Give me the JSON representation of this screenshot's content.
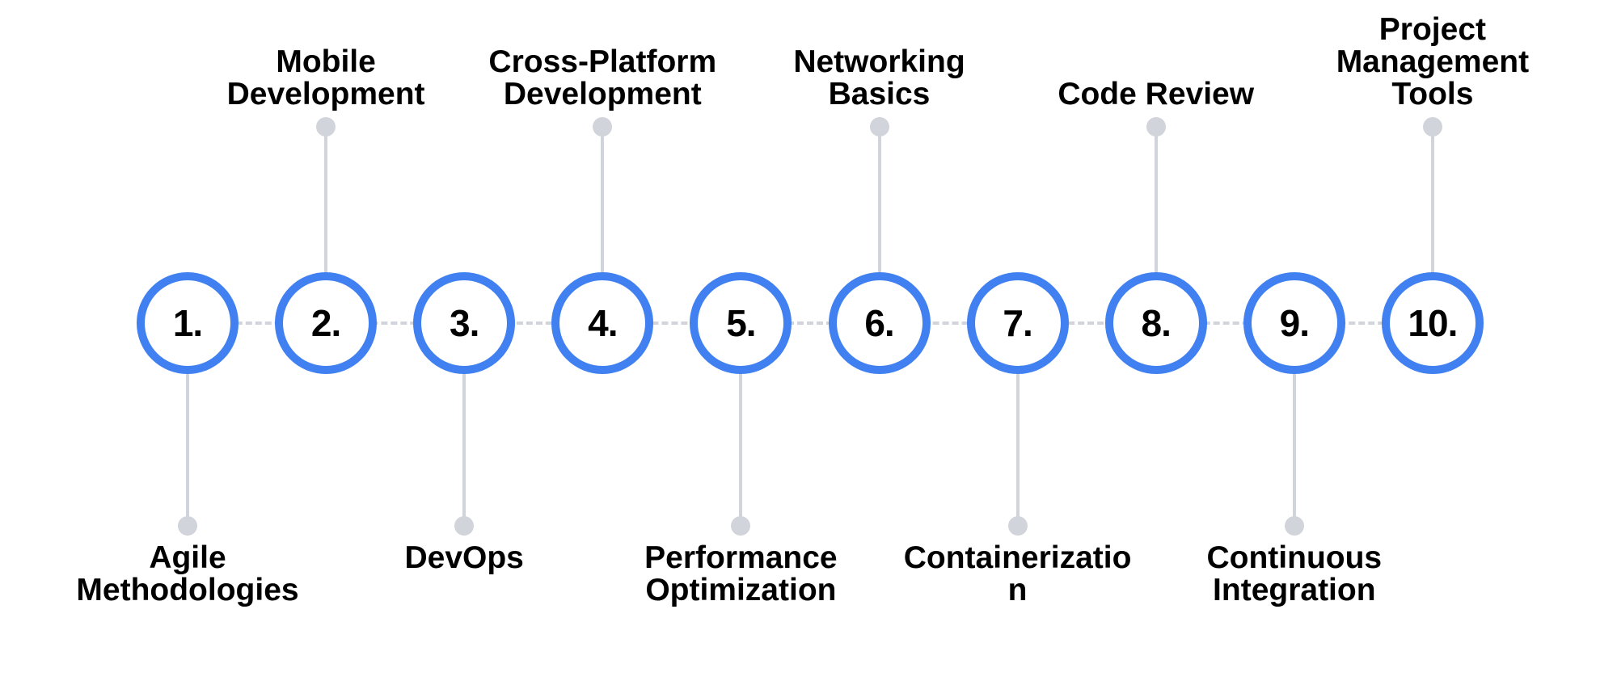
{
  "diagram": {
    "type": "horizontal-timeline",
    "accent_color": "#4080f0",
    "connector_color": "#d1d5db",
    "items": [
      {
        "number": "1.",
        "label": "Agile Methodologies",
        "position": "below"
      },
      {
        "number": "2.",
        "label": "Mobile Development",
        "position": "above"
      },
      {
        "number": "3.",
        "label": "DevOps",
        "position": "below"
      },
      {
        "number": "4.",
        "label": "Cross-Platform Development",
        "position": "above"
      },
      {
        "number": "5.",
        "label": "Performance Optimization",
        "position": "below"
      },
      {
        "number": "6.",
        "label": "Networking Basics",
        "position": "above"
      },
      {
        "number": "7.",
        "label": "Containerization",
        "position": "below"
      },
      {
        "number": "8.",
        "label": "Code Review",
        "position": "above"
      },
      {
        "number": "9.",
        "label": "Continuous Integration",
        "position": "below"
      },
      {
        "number": "10.",
        "label": "Project Management Tools",
        "position": "above"
      }
    ]
  }
}
